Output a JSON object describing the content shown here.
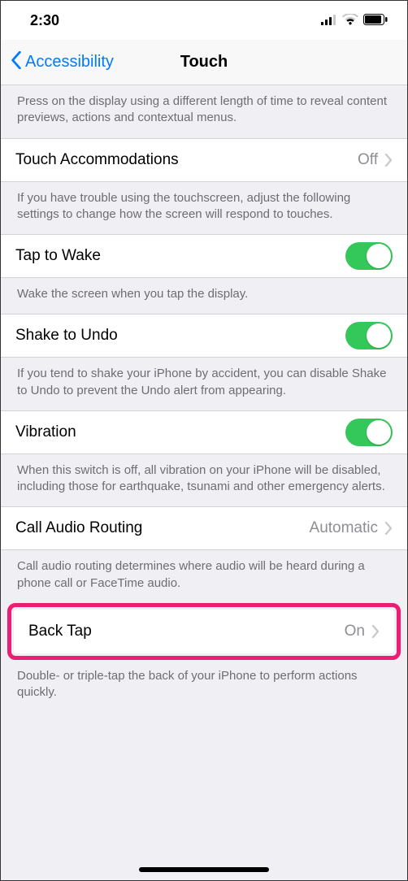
{
  "status": {
    "time": "2:30"
  },
  "nav": {
    "back_label": "Accessibility",
    "title": "Touch"
  },
  "section0": {
    "footer": "Press on the display using a different length of time to reveal content previews, actions and contextual menus."
  },
  "touch_accommodations": {
    "label": "Touch Accommodations",
    "value": "Off"
  },
  "touch_accommodations_footer": "If you have trouble using the touchscreen, adjust the following settings to change how the screen will respond to touches.",
  "tap_to_wake": {
    "label": "Tap to Wake"
  },
  "tap_to_wake_footer": "Wake the screen when you tap the display.",
  "shake_to_undo": {
    "label": "Shake to Undo"
  },
  "shake_to_undo_footer": "If you tend to shake your iPhone by accident, you can disable Shake to Undo to prevent the Undo alert from appearing.",
  "vibration": {
    "label": "Vibration"
  },
  "vibration_footer": "When this switch is off, all vibration on your iPhone will be disabled, including those for earthquake, tsunami and other emergency alerts.",
  "call_audio_routing": {
    "label": "Call Audio Routing",
    "value": "Automatic"
  },
  "call_audio_routing_footer": "Call audio routing determines where audio will be heard during a phone call or FaceTime audio.",
  "back_tap": {
    "label": "Back Tap",
    "value": "On"
  },
  "back_tap_footer": "Double- or triple-tap the back of your iPhone to perform actions quickly."
}
